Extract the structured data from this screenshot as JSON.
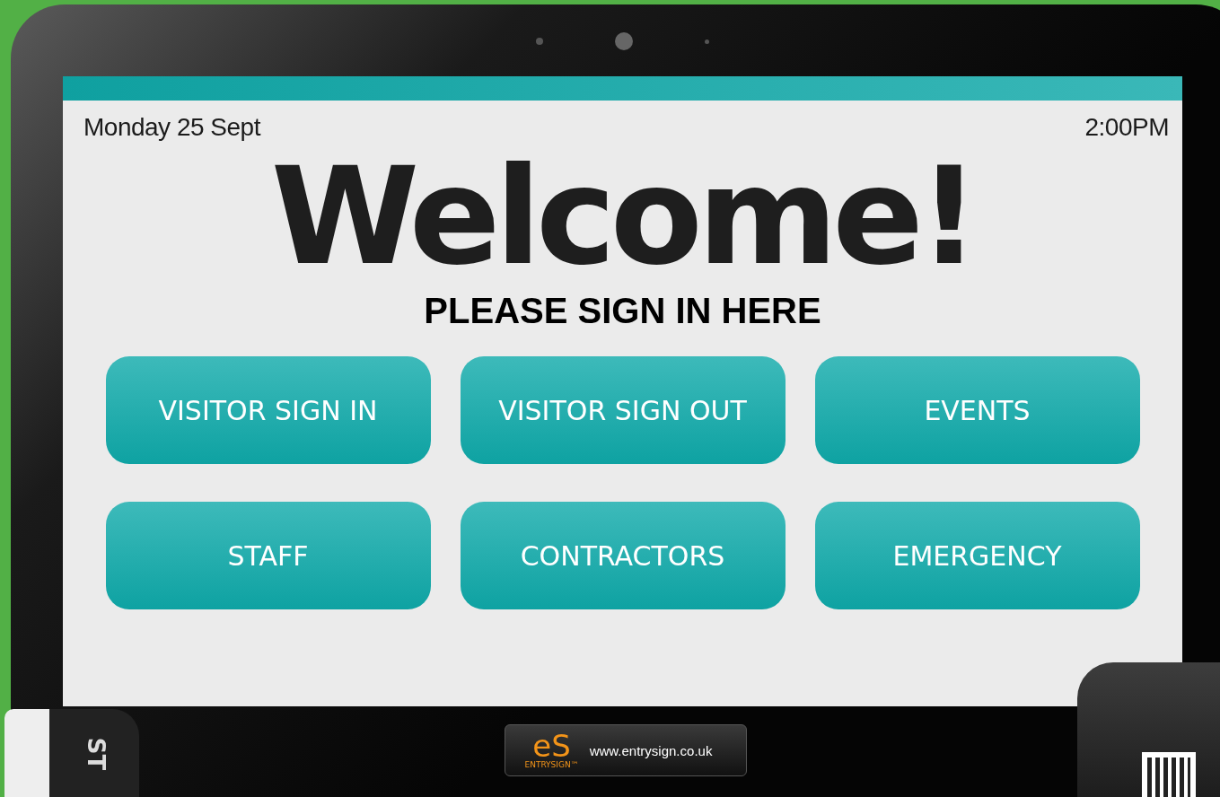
{
  "screen": {
    "date": "Monday 25 Sept",
    "time": "2:00PM",
    "title": "Welcome!",
    "subtitle": "PLEASE SIGN IN HERE",
    "buttons": [
      {
        "label": "VISITOR SIGN IN"
      },
      {
        "label": "VISITOR SIGN OUT"
      },
      {
        "label": "EVENTS"
      },
      {
        "label": "STAFF"
      },
      {
        "label": "CONTRACTORS"
      },
      {
        "label": "EMERGENCY"
      }
    ]
  },
  "badge": {
    "logo": "eS",
    "brand": "ENTRYSIGN™",
    "url": "www.entrysign.co.uk"
  },
  "lanyard": {
    "text": "ST"
  }
}
